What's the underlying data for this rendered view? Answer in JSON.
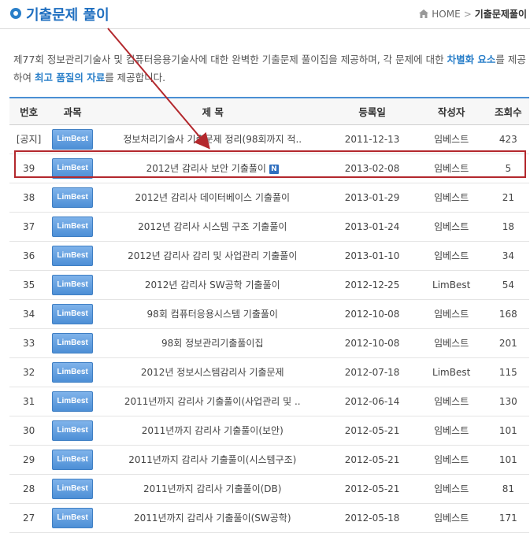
{
  "header": {
    "title": "기출문제 풀이",
    "breadcrumb": {
      "home": "HOME",
      "separator": ">",
      "current": "기출문제풀이"
    }
  },
  "intro": {
    "part1": "제77회 정보관리기술사 및 컴퓨터응용기술사에 대한 완벽한 기출문제 풀이집을 제공하며, 각 문제에 대한 ",
    "highlight1": "차별화 요소",
    "part2": "를 제공하여 ",
    "highlight2": "최고 품질의 자료",
    "part3": "를 제공합니다."
  },
  "table": {
    "headers": [
      "번호",
      "과목",
      "제 목",
      "등록일",
      "작성자",
      "조회수"
    ],
    "rows": [
      {
        "no": "[공지]",
        "subject": "LimBest",
        "title": "정보처리기술사 기출문제 정리(98회까지 적..",
        "date": "2011-12-13",
        "author": "임베스트",
        "views": "423",
        "new": ""
      },
      {
        "no": "39",
        "subject": "LimBest",
        "title": "2012년 감리사 보안 기출풀이",
        "date": "2013-02-08",
        "author": "임베스트",
        "views": "5",
        "new": "N"
      },
      {
        "no": "38",
        "subject": "LimBest",
        "title": "2012년 감리사 데이터베이스 기출풀이",
        "date": "2013-01-29",
        "author": "임베스트",
        "views": "21",
        "new": ""
      },
      {
        "no": "37",
        "subject": "LimBest",
        "title": "2012년 감리사 시스템 구조 기출풀이",
        "date": "2013-01-24",
        "author": "임베스트",
        "views": "18",
        "new": ""
      },
      {
        "no": "36",
        "subject": "LimBest",
        "title": "2012년 감리사 감리 및 사업관리 기출풀이",
        "date": "2013-01-10",
        "author": "임베스트",
        "views": "34",
        "new": ""
      },
      {
        "no": "35",
        "subject": "LimBest",
        "title": "2012년 감리사 SW공학 기출풀이",
        "date": "2012-12-25",
        "author": "LimBest",
        "views": "54",
        "new": ""
      },
      {
        "no": "34",
        "subject": "LimBest",
        "title": "98회 컴퓨터응용시스템 기출풀이",
        "date": "2012-10-08",
        "author": "임베스트",
        "views": "168",
        "new": ""
      },
      {
        "no": "33",
        "subject": "LimBest",
        "title": "98회 정보관리기출풀이집",
        "date": "2012-10-08",
        "author": "임베스트",
        "views": "201",
        "new": ""
      },
      {
        "no": "32",
        "subject": "LimBest",
        "title": "2012년 정보시스템감리사 기출문제",
        "date": "2012-07-18",
        "author": "LimBest",
        "views": "115",
        "new": ""
      },
      {
        "no": "31",
        "subject": "LimBest",
        "title": "2011년까지 감리사 기출풀이(사업관리 및 ..",
        "date": "2012-06-14",
        "author": "임베스트",
        "views": "130",
        "new": ""
      },
      {
        "no": "30",
        "subject": "LimBest",
        "title": "2011년까지 감리사 기출풀이(보안)",
        "date": "2012-05-21",
        "author": "임베스트",
        "views": "101",
        "new": ""
      },
      {
        "no": "29",
        "subject": "LimBest",
        "title": "2011년까지 감리사 기출풀이(시스템구조)",
        "date": "2012-05-21",
        "author": "임베스트",
        "views": "101",
        "new": ""
      },
      {
        "no": "28",
        "subject": "LimBest",
        "title": "2011년까지 감리사 기출풀이(DB)",
        "date": "2012-05-21",
        "author": "임베스트",
        "views": "81",
        "new": ""
      },
      {
        "no": "27",
        "subject": "LimBest",
        "title": "2011년까지 감리사 기출풀이(SW공학)",
        "date": "2012-05-18",
        "author": "임베스트",
        "views": "171",
        "new": ""
      }
    ]
  },
  "colors": {
    "accent": "#2a7fc9",
    "highlight_border": "#b3282d"
  }
}
